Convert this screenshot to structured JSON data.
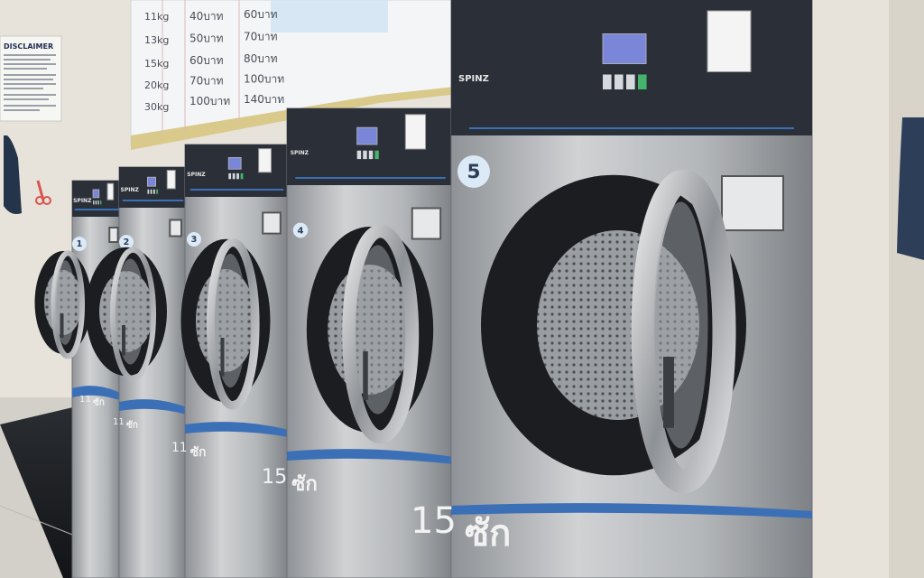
{
  "poster": {
    "rows": [
      {
        "kg": "11",
        "unit": "kg",
        "price": "40",
        "baht": "บาท",
        "price2": "60",
        "baht2": "บาท"
      },
      {
        "kg": "13",
        "unit": "kg",
        "price": "50",
        "baht": "บาท",
        "price2": "70",
        "baht2": "บาท"
      },
      {
        "kg": "15",
        "unit": "kg",
        "price": "60",
        "baht": "บาท",
        "price2": "80",
        "baht2": "บาท"
      },
      {
        "kg": "20",
        "unit": "kg",
        "price": "70",
        "baht": "บาท",
        "price2": "100",
        "baht2": "บาท"
      },
      {
        "kg": "30",
        "unit": "kg",
        "price": "100",
        "baht": "บาท",
        "price2": "140",
        "baht2": "บาท"
      }
    ]
  },
  "disclaimer": {
    "title": "DISCLAIMER"
  },
  "machines": [
    {
      "brand": "SPINZ",
      "number": "5",
      "capacity": "15",
      "label": "ซัก"
    },
    {
      "brand": "SPINZ",
      "number": "4",
      "capacity": "15",
      "label": "ซัก"
    },
    {
      "brand": "SPINZ",
      "number": "3",
      "capacity": "11",
      "label": "ซัก"
    },
    {
      "brand": "SPINZ",
      "number": "2",
      "capacity": "11",
      "label": "ซัก"
    },
    {
      "brand": "SPINZ",
      "number": "1",
      "capacity": "11",
      "label": "ซัก"
    }
  ],
  "colors": {
    "wall": "#e9e6df",
    "steel": "#b9bcbf",
    "panel": "#2b3038",
    "accent": "#3b6fb6",
    "floor": "#1d2024"
  }
}
